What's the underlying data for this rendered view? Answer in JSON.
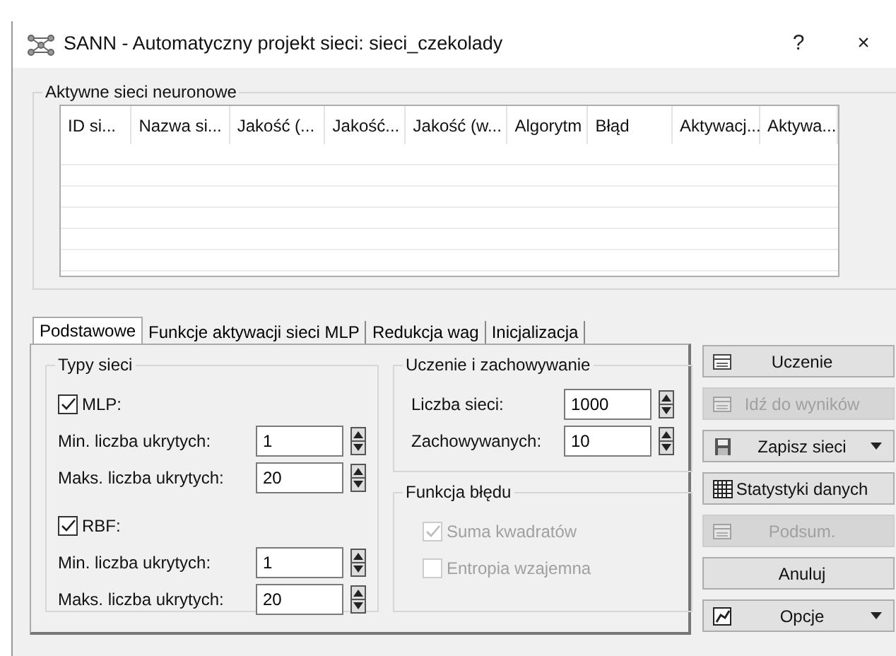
{
  "window": {
    "title": "SANN - Automatyczny projekt sieci: sieci_czekolady",
    "help": "?",
    "close": "×"
  },
  "networks": {
    "title": "Aktywne sieci neuronowe",
    "columns": [
      "ID si...",
      "Nazwa si...",
      "Jakość (...",
      "Jakość...",
      "Jakość (w...",
      "Algorytm",
      "Błąd",
      "Aktywacj...",
      "Aktywa..."
    ]
  },
  "tabs": [
    {
      "label": "Podstawowe",
      "selected": true
    },
    {
      "label": "Funkcje aktywacji sieci MLP",
      "selected": false
    },
    {
      "label": "Redukcja wag",
      "selected": false
    },
    {
      "label": "Inicjalizacja",
      "selected": false
    }
  ],
  "network_types": {
    "title": "Typy sieci",
    "types": [
      {
        "label": "MLP:",
        "checked": true,
        "fields": [
          {
            "label": "Min. liczba ukrytych:",
            "value": "1"
          },
          {
            "label": "Maks. liczba ukrytych:",
            "value": "20"
          }
        ]
      },
      {
        "label": "RBF:",
        "checked": true,
        "fields": [
          {
            "label": "Min. liczba ukrytych:",
            "value": "1"
          },
          {
            "label": "Maks. liczba ukrytych:",
            "value": "20"
          }
        ]
      }
    ]
  },
  "training": {
    "title": "Uczenie i zachowywanie",
    "fields": [
      {
        "label": "Liczba sieci:",
        "value": "1000"
      },
      {
        "label": "Zachowywanych:",
        "value": "10"
      }
    ]
  },
  "error_function": {
    "title": "Funkcja błędu",
    "options": [
      {
        "label": "Suma kwadratów",
        "checked": true,
        "disabled": true
      },
      {
        "label": "Entropia wzajemna",
        "checked": false,
        "disabled": true
      }
    ]
  },
  "buttons": [
    {
      "label": "Uczenie",
      "kind": "grid",
      "disabled": false,
      "dropdown": false
    },
    {
      "label": "Idź do wyników",
      "kind": "grid",
      "disabled": true,
      "dropdown": false
    },
    {
      "label": "Zapisz sieci",
      "kind": "disk",
      "disabled": false,
      "dropdown": true
    },
    {
      "label": "Statystyki danych",
      "kind": "table",
      "disabled": false,
      "dropdown": false
    },
    {
      "label": "Podsum.",
      "kind": "grid",
      "disabled": true,
      "dropdown": false
    },
    {
      "label": "Anuluj",
      "kind": "plain",
      "disabled": false,
      "dropdown": false
    },
    {
      "label": "Opcje",
      "kind": "chart",
      "disabled": false,
      "dropdown": true
    }
  ]
}
